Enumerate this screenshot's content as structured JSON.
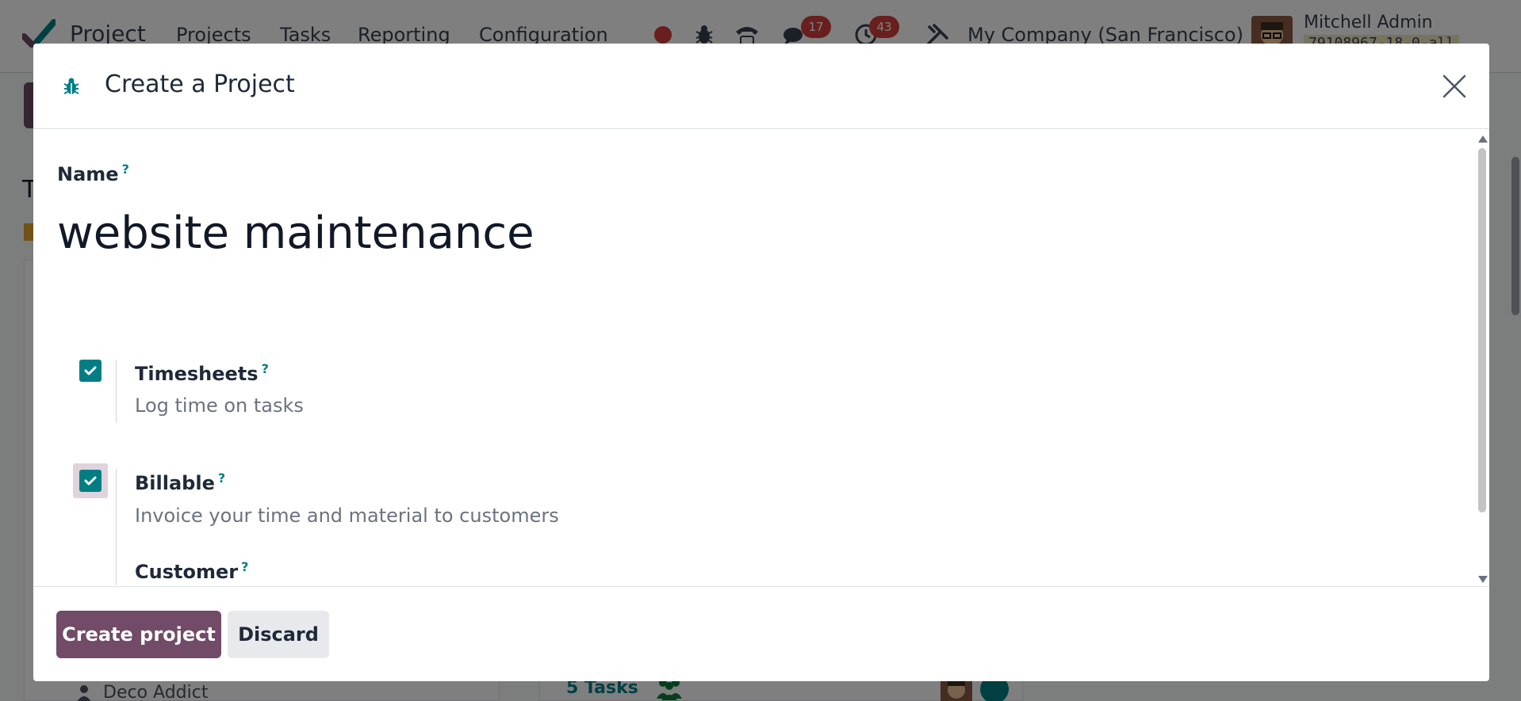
{
  "app": {
    "name": "Project",
    "nav": [
      "Projects",
      "Tasks",
      "Reporting",
      "Configuration"
    ],
    "badges": {
      "messages": "17",
      "activities": "43"
    },
    "company": "My Company (San Francisco)",
    "user_name": "Mitchell Admin",
    "db_name": "79108967-18-0-all"
  },
  "background": {
    "customer": "Deco Addict",
    "tasks": "5 Tasks"
  },
  "modal": {
    "title": "Create a Project",
    "name_label": "Name",
    "name_value": "website maintenance",
    "help_mark": "?",
    "timesheets": {
      "label": "Timesheets",
      "description": "Log time on tasks",
      "checked": true
    },
    "billable": {
      "label": "Billable",
      "description": "Invoice your time and material to customers",
      "checked": true
    },
    "customer_label": "Customer",
    "create_button": "Create project",
    "discard_button": "Discard"
  },
  "colors": {
    "primary": "#714b67",
    "accent": "#017e84",
    "badge": "#d23f3a"
  }
}
